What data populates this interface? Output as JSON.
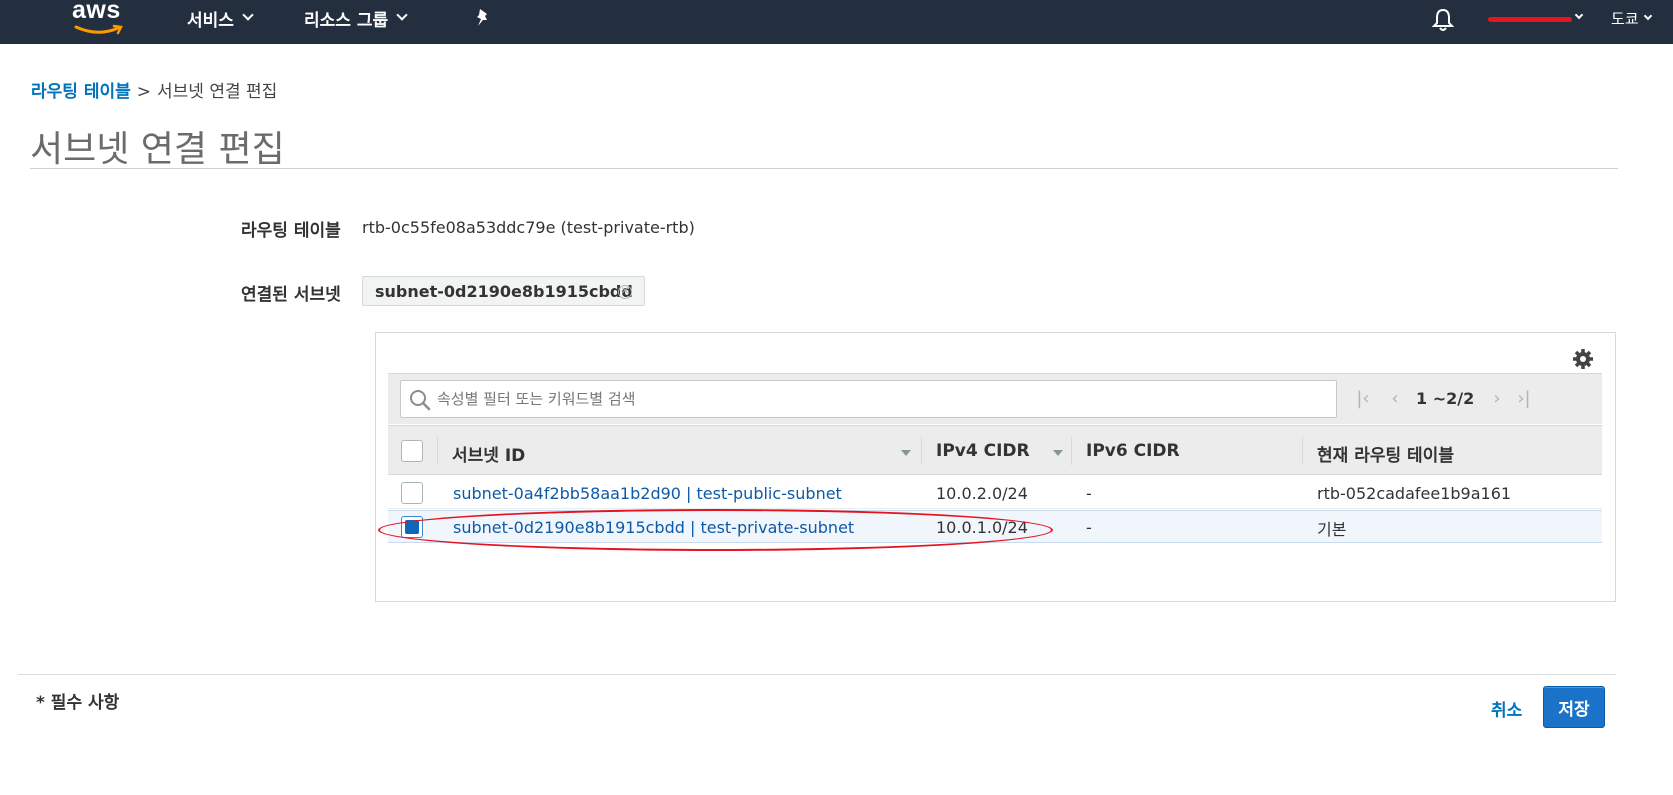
{
  "nav": {
    "logo": "aws",
    "services": "서비스",
    "resource_groups": "리소스 그룹",
    "region": "도쿄"
  },
  "breadcrumb": {
    "parent": "라우팅 테이블",
    "separator": ">",
    "current": "서브넷 연결 편집"
  },
  "page_title": "서브넷 연결 편집",
  "form": {
    "route_table_label": "라우팅 테이블",
    "route_table_value": "rtb-0c55fe08a53ddc79e (test-private-rtb)",
    "associated_label": "연결된 서브넷",
    "associated_token": "subnet-0d2190e8b1915cbdd"
  },
  "toolbar": {
    "search_placeholder": "속성별 필터 또는 키워드별 검색",
    "page_range": "1 ~2/2"
  },
  "table": {
    "columns": [
      "서브넷 ID",
      "IPv4 CIDR",
      "IPv6 CIDR",
      "현재 라우팅 테이블"
    ],
    "rows": [
      {
        "subnet": "subnet-0a4f2bb58aa1b2d90 | test-public-subnet",
        "ipv4": "10.0.2.0/24",
        "ipv6": "-",
        "route_table": "rtb-052cadafee1b9a161",
        "checked": false
      },
      {
        "subnet": "subnet-0d2190e8b1915cbdd | test-private-subnet",
        "ipv4": "10.0.1.0/24",
        "ipv6": "-",
        "route_table": "기본",
        "checked": true
      }
    ]
  },
  "footer": {
    "required_note": "* 필수 사항",
    "cancel_label": "취소",
    "save_label": "저장"
  },
  "colors": {
    "nav_bg": "#232f3e",
    "link": "#0073bb",
    "primary_button": "#1a73c8",
    "highlight_annotation": "#e3141f"
  }
}
